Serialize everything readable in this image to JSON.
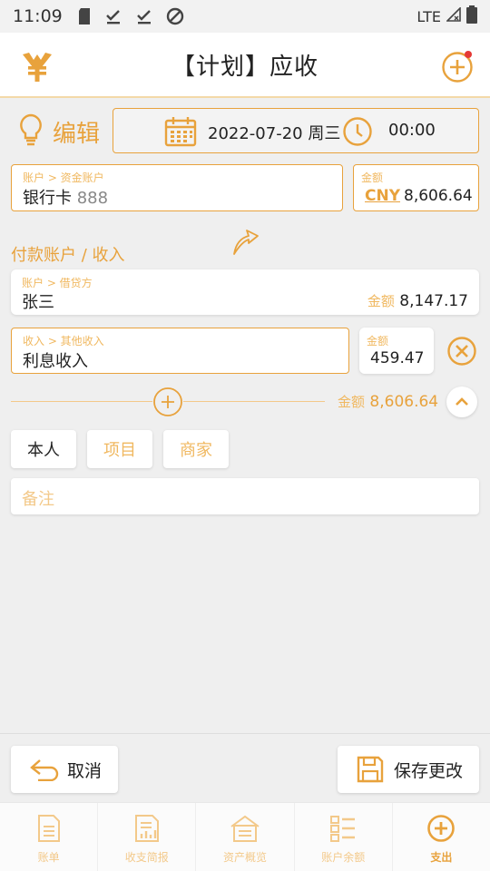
{
  "status_bar": {
    "time": "11:09",
    "network": "LTE"
  },
  "header": {
    "title": "【计划】应收"
  },
  "mode": {
    "label": "编辑"
  },
  "datetime": {
    "date": "2022-07-20 周三",
    "time": "00:00"
  },
  "source_account": {
    "caption": "账户 > 资金账户",
    "name": "银行卡",
    "number": "888"
  },
  "source_amount": {
    "caption": "金额",
    "currency": "CNY",
    "value": "8,606.64"
  },
  "section_title": "付款账户 / 收入",
  "payer": {
    "caption": "账户 > 借贷方",
    "name": "张三",
    "amount_label": "金额",
    "amount": "8,147.17"
  },
  "income": {
    "caption": "收入 > 其他收入",
    "name": "利息收入",
    "amount_caption": "金额",
    "amount": "459.47"
  },
  "total": {
    "label": "金额",
    "value": "8,606.64"
  },
  "tags": {
    "person": "本人",
    "project": "项目",
    "merchant": "商家"
  },
  "note": {
    "placeholder": "备注"
  },
  "actions": {
    "cancel": "取消",
    "save": "保存更改"
  },
  "nav": [
    {
      "label": "账单"
    },
    {
      "label": "收支简报"
    },
    {
      "label": "资产概览"
    },
    {
      "label": "账户余额"
    },
    {
      "label": "支出"
    }
  ],
  "colors": {
    "accent": "#e8a23c",
    "accent_light": "#f3c98a",
    "notification": "#e53935"
  }
}
